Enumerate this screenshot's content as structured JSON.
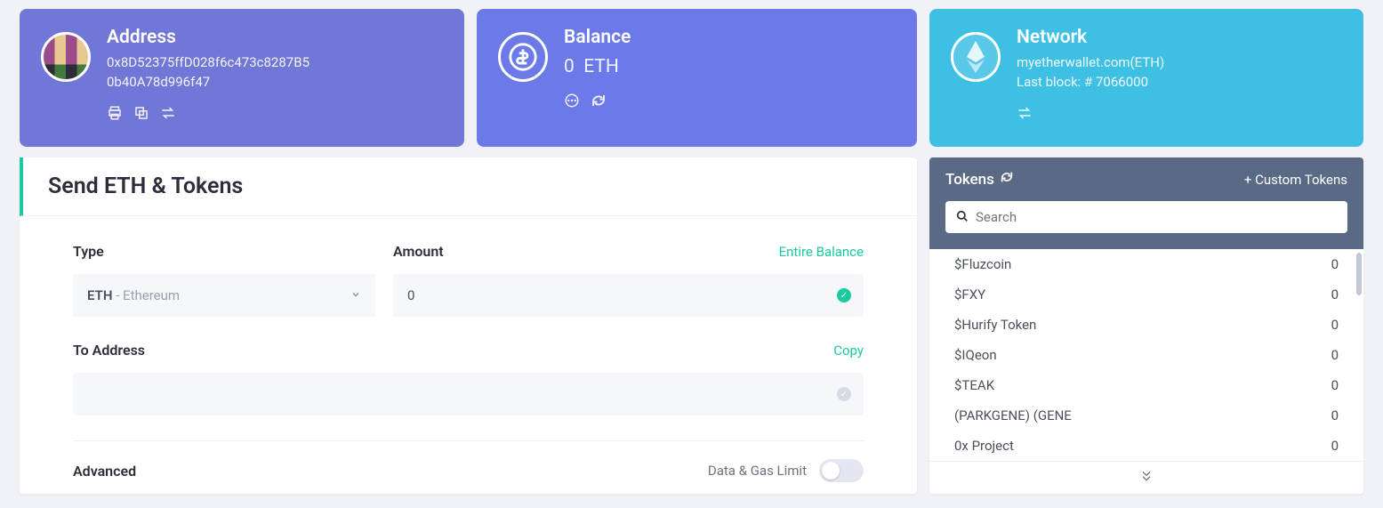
{
  "cards": {
    "address": {
      "title": "Address",
      "line1": "0x8D52375ffD028f6c473c8287B5",
      "line2": "0b40A78d996f47"
    },
    "balance": {
      "title": "Balance",
      "amount": "0",
      "symbol": "ETH"
    },
    "network": {
      "title": "Network",
      "provider": "myetherwallet.com(ETH)",
      "lastblock_label": "Last block: # ",
      "lastblock": "7066000"
    }
  },
  "send": {
    "title": "Send ETH & Tokens",
    "type_label": "Type",
    "type_symbol": "ETH",
    "type_name": " - Ethereum",
    "amount_label": "Amount",
    "entire_balance": "Entire Balance",
    "amount_value": "0",
    "to_label": "To Address",
    "copy": "Copy",
    "to_value": "",
    "advanced_label": "Advanced",
    "gas_label": "Data & Gas Limit"
  },
  "tokens": {
    "title": "Tokens",
    "custom": "+ Custom Tokens",
    "search_placeholder": "Search",
    "items": [
      {
        "name": "$Fluzcoin",
        "balance": "0"
      },
      {
        "name": "$FXY",
        "balance": "0"
      },
      {
        "name": "$Hurify Token",
        "balance": "0"
      },
      {
        "name": "$IQeon",
        "balance": "0"
      },
      {
        "name": "$TEAK",
        "balance": "0"
      },
      {
        "name": "(PARKGENE) (GENE",
        "balance": "0"
      },
      {
        "name": "0x Project",
        "balance": "0"
      }
    ]
  }
}
